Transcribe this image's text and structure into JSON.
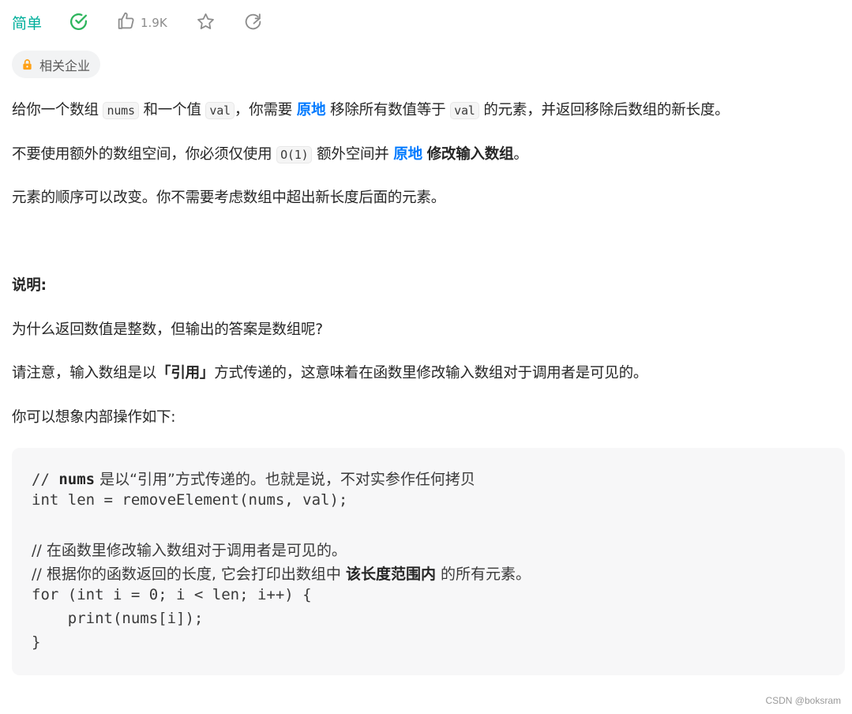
{
  "header": {
    "difficulty": "简单",
    "like_count": "1.9K",
    "accent_color": "#00af9b"
  },
  "tags": {
    "company_label": "相关企业"
  },
  "description": {
    "p1": {
      "t1": "给你一个数组 ",
      "code1": "nums",
      "t2": " 和一个值 ",
      "code2": "val",
      "t3": "，你需要 ",
      "b1": "原地",
      "t4": " 移除所有数值等于 ",
      "code3": "val",
      "t5": " 的元素，并返回移除后数组的新长度。"
    },
    "p2": {
      "t1": "不要使用额外的数组空间，你必须仅使用 ",
      "code1": "O(1)",
      "t2": " 额外空间并 ",
      "b1": "原地",
      "t3": " ",
      "b2": "修改输入数组",
      "t4": "。"
    },
    "p3": "元素的顺序可以改变。你不需要考虑数组中超出新长度后面的元素。"
  },
  "explanation": {
    "heading": "说明:",
    "q": "为什么返回数值是整数，但输出的答案是数组呢?",
    "p1": {
      "t1": "请注意，输入数组是以",
      "b1": "「引用」",
      "t2": "方式传递的，这意味着在函数里修改输入数组对于调用者是可见的。"
    },
    "p2": "你可以想象内部操作如下:"
  },
  "code": {
    "l1_a": "// ",
    "l1_b": "nums",
    "l1_c": " 是以“引用”方式传递的。也就是说，不对实参作任何拷贝",
    "l2": "int len = removeElement(nums, val);",
    "l4": "// 在函数里修改输入数组对于调用者是可见的。",
    "l5_a": "// 根据你的函数返回的长度, 它会打印出数组中 ",
    "l5_b": "该长度范围内",
    "l5_c": " 的所有元素。",
    "l6": "for (int i = 0; i < len; i++) {",
    "l7": "    print(nums[i]);",
    "l8": "}"
  },
  "watermark": "CSDN @boksram"
}
